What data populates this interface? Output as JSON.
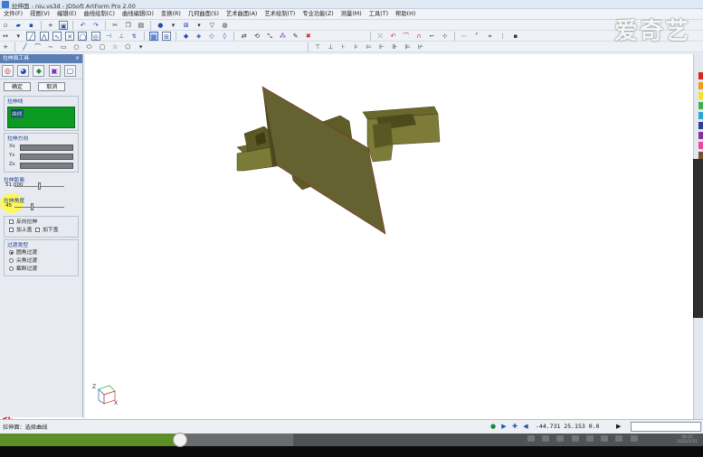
{
  "window": {
    "title": "拉伸面 - niu.vs3d - JDSoft ArtForm Pro 2.00"
  },
  "watermark": "爱奇艺",
  "menubar": {
    "items": [
      "文件(F)",
      "视图(V)",
      "编辑(E)",
      "曲线绘制(C)",
      "曲线编辑(D)",
      "变换(R)",
      "几何曲面(S)",
      "艺术曲面(A)",
      "艺术绘制(T)",
      "专业功能(Z)",
      "测量(M)",
      "工具(T)",
      "帮助(H)"
    ]
  },
  "left_panel": {
    "header": "拉伸面工具",
    "close": "×",
    "ok_label": "确定",
    "cancel_label": "取消",
    "stretch_line_label": "拉伸线",
    "stretch_line_value": "曲线",
    "direction_label": "拉伸方向",
    "dir_x": "Xs",
    "dir_y": "Ys",
    "dir_z": "Zs",
    "distance_label": "拉伸距离",
    "distance_value": "51.000",
    "angle_label": "拉伸角度",
    "angle_value": "45",
    "reverse_label": "反向拉伸",
    "top_cap_label": "加上盖",
    "bottom_cap_label": "加下盖",
    "transition_label": "过渡类型",
    "transition_options": [
      "圆角过渡",
      "尖角过渡",
      "截断过渡"
    ],
    "transition_selected": "圆角过渡"
  },
  "promo": {
    "chars": [
      "欣",
      "华",
      "浮",
      "雕"
    ]
  },
  "viewport": {
    "model_color": "#6b6a2e",
    "axes": {
      "x": "X",
      "z": "Z"
    }
  },
  "statusbar": {
    "status_text": "拉伸面：选择曲线",
    "coords": "-44.731 25.153 0.0"
  },
  "video": {
    "progress": 0.256,
    "clock_time": "08:01",
    "clock_date": "2022/1/21"
  },
  "colors": {
    "accent": "#3b6fb8",
    "selection_green": "#0c9a22",
    "progress_green": "#5c8f2a",
    "brand_red": "#c6131b"
  }
}
